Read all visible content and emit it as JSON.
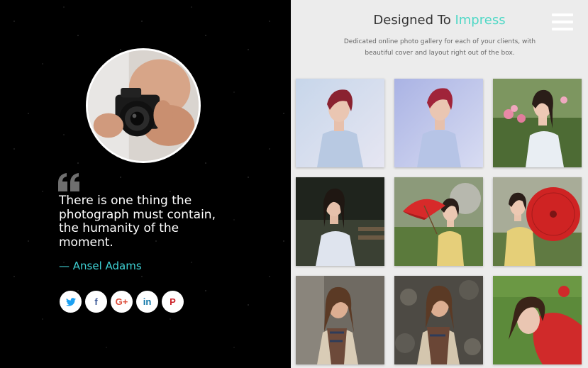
{
  "header": {
    "title_main": "Designed To",
    "title_accent": "Impress",
    "subtitle": "Dedicated online photo gallery for each of your clients, with beautiful cover and layout right out of the box.",
    "accent_color": "#4fd8c6"
  },
  "profile": {
    "avatar_icon": "photographer-avatar"
  },
  "quote": {
    "icon": "quote-icon",
    "text": "There is one thing the photograph must contain, the humanity of the moment.",
    "author": "— Ansel Adams",
    "author_color": "#3fd1d4"
  },
  "socials": [
    {
      "name": "twitter",
      "glyph": "🐦",
      "label": "t"
    },
    {
      "name": "facebook",
      "label": "f"
    },
    {
      "name": "google-plus",
      "label": "G+"
    },
    {
      "name": "linkedin",
      "label": "in"
    },
    {
      "name": "pinterest",
      "label": "P"
    }
  ],
  "menu": {
    "icon": "hamburger-menu-icon"
  },
  "gallery": [
    {
      "name": "photo-woman-blue-shirt-1"
    },
    {
      "name": "photo-woman-blue-shirt-2"
    },
    {
      "name": "photo-woman-white-dress-flowers"
    },
    {
      "name": "photo-woman-white-dress-bench"
    },
    {
      "name": "photo-woman-red-umbrella-1"
    },
    {
      "name": "photo-woman-red-umbrella-2"
    },
    {
      "name": "photo-woman-plaid-scarf-1"
    },
    {
      "name": "photo-woman-plaid-scarf-2"
    },
    {
      "name": "photo-woman-red-jacket-grass"
    }
  ]
}
